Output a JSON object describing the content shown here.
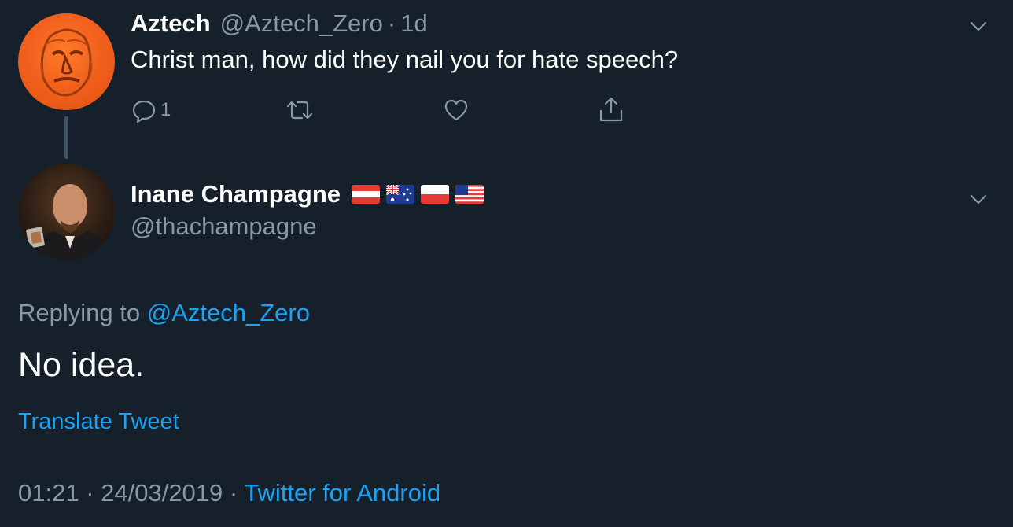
{
  "parent_tweet": {
    "author_name": "Aztech",
    "handle": "@Aztech_Zero",
    "separator": "·",
    "time": "1d",
    "text": "Christ man, how did they nail you for hate speech?",
    "reply_count": "1",
    "icons": {
      "reply": "reply-icon",
      "retweet": "retweet-icon",
      "like": "like-icon",
      "share": "share-icon",
      "menu": "chevron-down-icon"
    }
  },
  "main_tweet": {
    "author_name": "Inane Champagne",
    "handle": "@thachampagne",
    "flags": [
      "flag-austria",
      "flag-australia",
      "flag-poland",
      "flag-usa"
    ],
    "replying_prefix": "Replying to ",
    "replying_handle": "@Aztech_Zero",
    "text": "No idea.",
    "translate_label": "Translate Tweet",
    "timestamp": "01:21 · 24/03/2019 · ",
    "source": "Twitter for Android"
  },
  "colors": {
    "background": "#15202b",
    "muted": "#8899a6",
    "accent": "#1da1f2",
    "text": "#ffffff"
  }
}
